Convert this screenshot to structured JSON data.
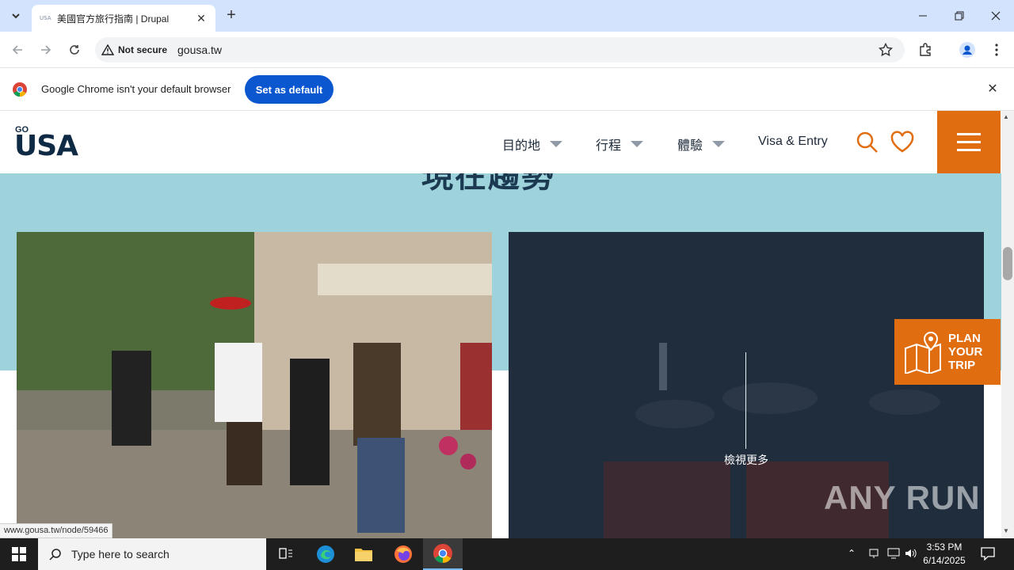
{
  "browser": {
    "tab_title": "美國官方旅行指南 | Drupal",
    "tab_favicon": "USA",
    "security_label": "Not secure",
    "url": "gousa.tw",
    "infobar_text": "Google Chrome isn't your default browser",
    "set_default_label": "Set as default",
    "status_link": "www.gousa.tw/node/59466"
  },
  "site": {
    "logo_go": "GO",
    "logo_usa": "USA",
    "nav": [
      {
        "label": "目的地"
      },
      {
        "label": "行程"
      },
      {
        "label": "體驗"
      },
      {
        "label": "Visa & Entry"
      }
    ],
    "section_title": "現在趨勢",
    "view_more": "檢視更多",
    "plan_trip": "PLAN YOUR TRIP",
    "watermark": "ANY RUN",
    "colors": {
      "accent": "#e06d10",
      "teal": "#9fd3dc",
      "navy": "#1b3a52"
    }
  },
  "taskbar": {
    "search_placeholder": "Type here to search",
    "time": "3:53 PM",
    "date": "6/14/2025"
  }
}
